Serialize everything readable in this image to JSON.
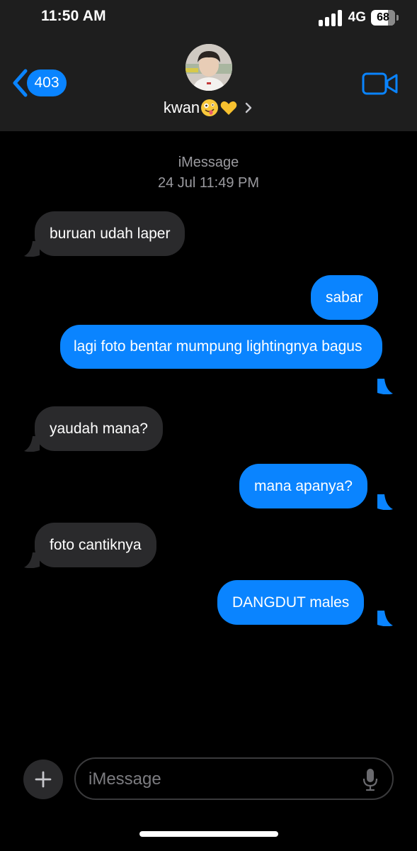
{
  "status_bar": {
    "time": "11:50 AM",
    "network": "4G",
    "battery": "68"
  },
  "nav": {
    "back_count": "403",
    "contact_name": "kwan",
    "contact_emojis": [
      "zany-face-emoji",
      "yellow-heart-emoji"
    ]
  },
  "thread": {
    "service": "iMessage",
    "timestamp": "24 Jul 11:49 PM"
  },
  "messages": [
    {
      "id": "m1",
      "direction": "incoming",
      "text": "buruan udah laper"
    },
    {
      "id": "m2",
      "direction": "outgoing",
      "text": "sabar"
    },
    {
      "id": "m3",
      "direction": "outgoing",
      "text": "lagi foto bentar mumpung lightingnya bagus"
    },
    {
      "id": "m4",
      "direction": "incoming",
      "text": "yaudah mana?"
    },
    {
      "id": "m5",
      "direction": "outgoing",
      "text": "mana apanya?"
    },
    {
      "id": "m6",
      "direction": "incoming",
      "text": "foto cantiknya"
    },
    {
      "id": "m7",
      "direction": "outgoing",
      "text": "DANGDUT males"
    }
  ],
  "compose": {
    "placeholder": "iMessage"
  },
  "colors": {
    "accent": "#0a84ff",
    "incoming_bubble": "#2a2a2c",
    "header_bg": "#1e1e1e",
    "background": "#000000"
  }
}
